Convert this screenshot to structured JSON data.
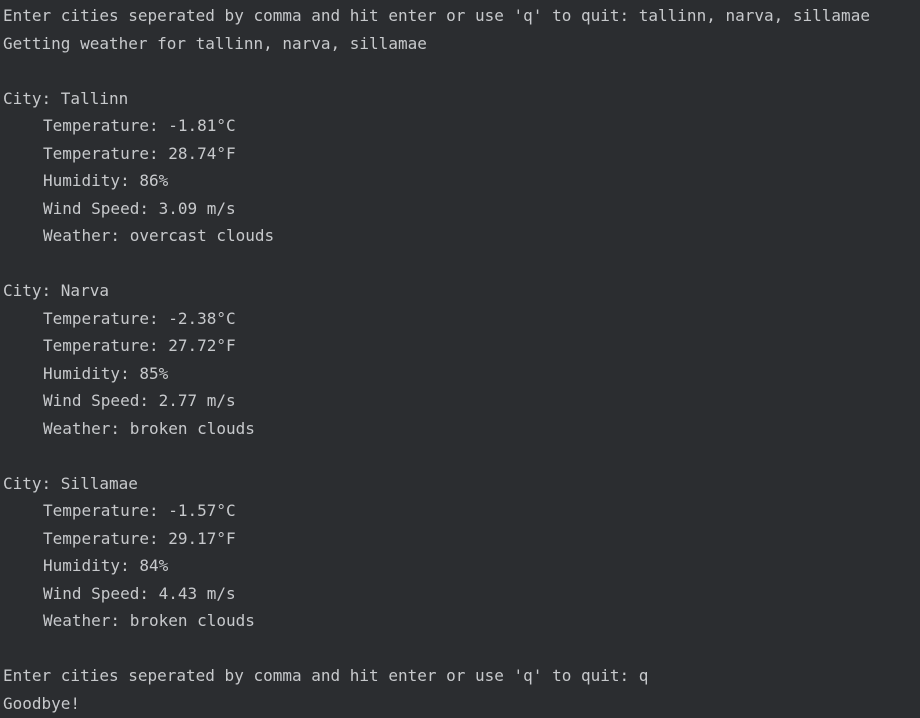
{
  "colors": {
    "background": "#2b2d30",
    "text": "#c7c9cc"
  },
  "prompt1": {
    "text": "Enter cities seperated by comma and hit enter or use 'q' to quit: ",
    "input": "tallinn, narva, sillamae"
  },
  "status": "Getting weather for tallinn, narva, sillamae",
  "cities": [
    {
      "city": "City: Tallinn",
      "temp_c": "Temperature: -1.81°C",
      "temp_f": "Temperature: 28.74°F",
      "humidity": "Humidity: 86%",
      "wind": "Wind Speed: 3.09 m/s",
      "weather": "Weather: overcast clouds"
    },
    {
      "city": "City: Narva",
      "temp_c": "Temperature: -2.38°C",
      "temp_f": "Temperature: 27.72°F",
      "humidity": "Humidity: 85%",
      "wind": "Wind Speed: 2.77 m/s",
      "weather": "Weather: broken clouds"
    },
    {
      "city": "City: Sillamae",
      "temp_c": "Temperature: -1.57°C",
      "temp_f": "Temperature: 29.17°F",
      "humidity": "Humidity: 84%",
      "wind": "Wind Speed: 4.43 m/s",
      "weather": "Weather: broken clouds"
    }
  ],
  "prompt2": {
    "text": "Enter cities seperated by comma and hit enter or use 'q' to quit: ",
    "input": "q"
  },
  "goodbye": "Goodbye!"
}
